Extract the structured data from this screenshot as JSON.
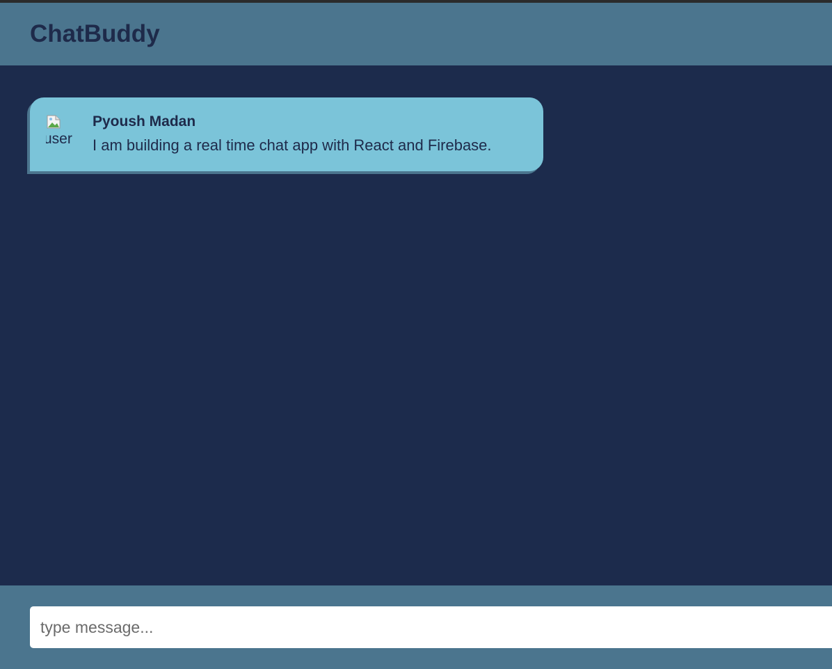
{
  "app": {
    "title": "ChatBuddy"
  },
  "messages": [
    {
      "avatar_alt": "user",
      "sender": "Pyoush Madan",
      "text": "I am building a real time chat app with React and Firebase."
    }
  ],
  "composer": {
    "placeholder": "type message..."
  },
  "colors": {
    "header_bg": "#4b758e",
    "chat_bg": "#1c2b4c",
    "bubble_bg": "#7bc4d9",
    "text_dark": "#1e2a4a"
  }
}
